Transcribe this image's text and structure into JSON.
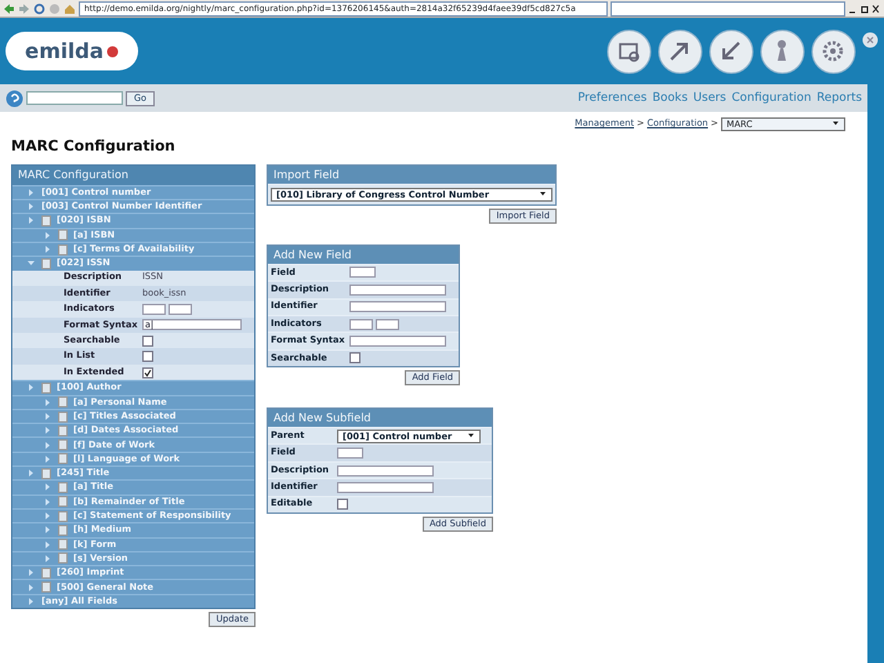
{
  "browser": {
    "url": "http://demo.emilda.org/nightly/marc_configuration.php?id=1376206145&auth=2814a32f65239d4faee39df5cd827c5a"
  },
  "header": {
    "logo": "emilda"
  },
  "toolbar": {
    "go_button": "Go",
    "nav": [
      "Preferences",
      "Books",
      "Users",
      "Configuration",
      "Reports"
    ]
  },
  "breadcrumb": {
    "links": [
      "Management",
      "Configuration"
    ],
    "separators": [
      ">",
      ">"
    ],
    "select": "MARC"
  },
  "page_title": "MARC Configuration",
  "tree": {
    "title": "MARC Configuration",
    "items": [
      {
        "label": "[001] Control number",
        "kind": "plain",
        "expanded": false
      },
      {
        "label": "[003] Control Number Identifier",
        "kind": "plain",
        "expanded": false
      },
      {
        "label": "[020] ISBN",
        "kind": "doc",
        "expanded": false,
        "children": [
          {
            "label": "[a] ISBN",
            "kind": "doc",
            "expanded": false
          },
          {
            "label": "[c] Terms Of Availability",
            "kind": "doc",
            "expanded": false
          }
        ]
      },
      {
        "label": "[022] ISSN",
        "kind": "doc",
        "expanded": true,
        "details": [
          {
            "label": "Description",
            "kind": "text",
            "value": "ISSN"
          },
          {
            "label": "Identifier",
            "kind": "text",
            "value": "book_issn"
          },
          {
            "label": "Indicators",
            "kind": "pair"
          },
          {
            "label": "Format Syntax",
            "kind": "input",
            "value": "a|"
          },
          {
            "label": "Searchable",
            "kind": "check",
            "checked": false
          },
          {
            "label": "In List",
            "kind": "check",
            "checked": false
          },
          {
            "label": "In Extended",
            "kind": "check",
            "checked": true
          }
        ]
      },
      {
        "label": "[100] Author",
        "kind": "doc",
        "expanded": false,
        "children": [
          {
            "label": "[a] Personal Name",
            "kind": "doc",
            "expanded": false
          },
          {
            "label": "[c] Titles Associated",
            "kind": "doc",
            "expanded": false
          },
          {
            "label": "[d] Dates Associated",
            "kind": "doc",
            "expanded": false
          },
          {
            "label": "[f] Date of Work",
            "kind": "doc",
            "expanded": false
          },
          {
            "label": "[l] Language of Work",
            "kind": "doc",
            "expanded": false
          }
        ]
      },
      {
        "label": "[245] Title",
        "kind": "doc",
        "expanded": false,
        "children": [
          {
            "label": "[a] Title",
            "kind": "doc",
            "expanded": false
          },
          {
            "label": "[b] Remainder of Title",
            "kind": "doc",
            "expanded": false
          },
          {
            "label": "[c] Statement of Responsibility",
            "kind": "doc",
            "expanded": false
          },
          {
            "label": "[h] Medium",
            "kind": "doc",
            "expanded": false
          },
          {
            "label": "[k] Form",
            "kind": "doc",
            "expanded": false
          },
          {
            "label": "[s] Version",
            "kind": "doc",
            "expanded": false
          }
        ]
      },
      {
        "label": "[260] Imprint",
        "kind": "doc",
        "expanded": false
      },
      {
        "label": "[500] General Note",
        "kind": "doc",
        "expanded": false
      },
      {
        "label": "[any] All Fields",
        "kind": "plain",
        "expanded": false
      }
    ],
    "update_button": "Update"
  },
  "import_field": {
    "title": "Import Field",
    "select": "[010] Library of Congress Control Number",
    "button": "Import Field"
  },
  "add_field": {
    "title": "Add New Field",
    "rows": [
      {
        "label": "Field",
        "kind": "short"
      },
      {
        "label": "Description",
        "kind": "input"
      },
      {
        "label": "Identifier",
        "kind": "input"
      },
      {
        "label": "Indicators",
        "kind": "pair"
      },
      {
        "label": "Format Syntax",
        "kind": "input"
      },
      {
        "label": "Searchable",
        "kind": "check",
        "checked": false
      }
    ],
    "button": "Add Field"
  },
  "add_subfield": {
    "title": "Add New Subfield",
    "rows": [
      {
        "label": "Parent",
        "kind": "select",
        "value": "[001] Control number"
      },
      {
        "label": "Field",
        "kind": "short"
      },
      {
        "label": "Description",
        "kind": "input"
      },
      {
        "label": "Identifier",
        "kind": "input"
      },
      {
        "label": "Editable",
        "kind": "check",
        "checked": false
      }
    ],
    "button": "Add Subfield"
  }
}
